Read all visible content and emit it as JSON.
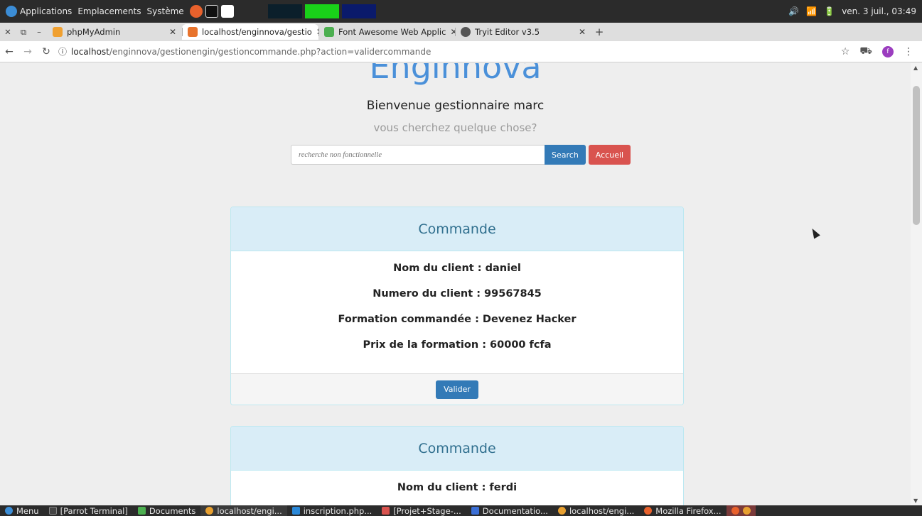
{
  "os_panel": {
    "menus": [
      "Applications",
      "Emplacements",
      "Système"
    ],
    "datetime": "ven. 3 juil., 03:49"
  },
  "browser": {
    "tabs": [
      {
        "label": "phpMyAdmin",
        "active": false
      },
      {
        "label": "localhost/enginnova/gestio",
        "active": true
      },
      {
        "label": "Font Awesome Web Applic",
        "active": false
      },
      {
        "label": "Tryit Editor v3.5",
        "active": false
      }
    ],
    "new_tab": "+",
    "url_host": "localhost",
    "url_path": "/enginnova/gestionengin/gestioncommande.php?action=validercommande",
    "profile_initial": "f"
  },
  "page": {
    "brand": "Enginnova",
    "welcome": "Bienvenue gestionnaire marc",
    "subtitle": "vous cherchez quelque chose?",
    "search_placeholder": "recherche non fonctionnelle",
    "search_button": "Search",
    "home_button": "Accueil",
    "orders": [
      {
        "heading": "Commande",
        "client_name": "Nom du client : daniel",
        "client_number": "Numero du client : 99567845",
        "course": "Formation commandée : Devenez Hacker",
        "price": "Prix de la formation : 60000 fcfa",
        "validate_button": "Valider"
      },
      {
        "heading": "Commande",
        "client_name": "Nom du client : ferdi"
      }
    ]
  },
  "taskbar": {
    "items": [
      "Menu",
      "[Parrot Terminal]",
      "Documents",
      "localhost/engi...",
      "inscription.php...",
      "[Projet+Stage-...",
      "Documentatio...",
      "localhost/engi...",
      "Mozilla Firefox..."
    ]
  },
  "colors": {
    "brand": "#4a90d9",
    "primary": "#337ab7",
    "danger": "#d9534f",
    "panel_heading_bg": "#d9edf7",
    "panel_heading_text": "#31708f"
  }
}
